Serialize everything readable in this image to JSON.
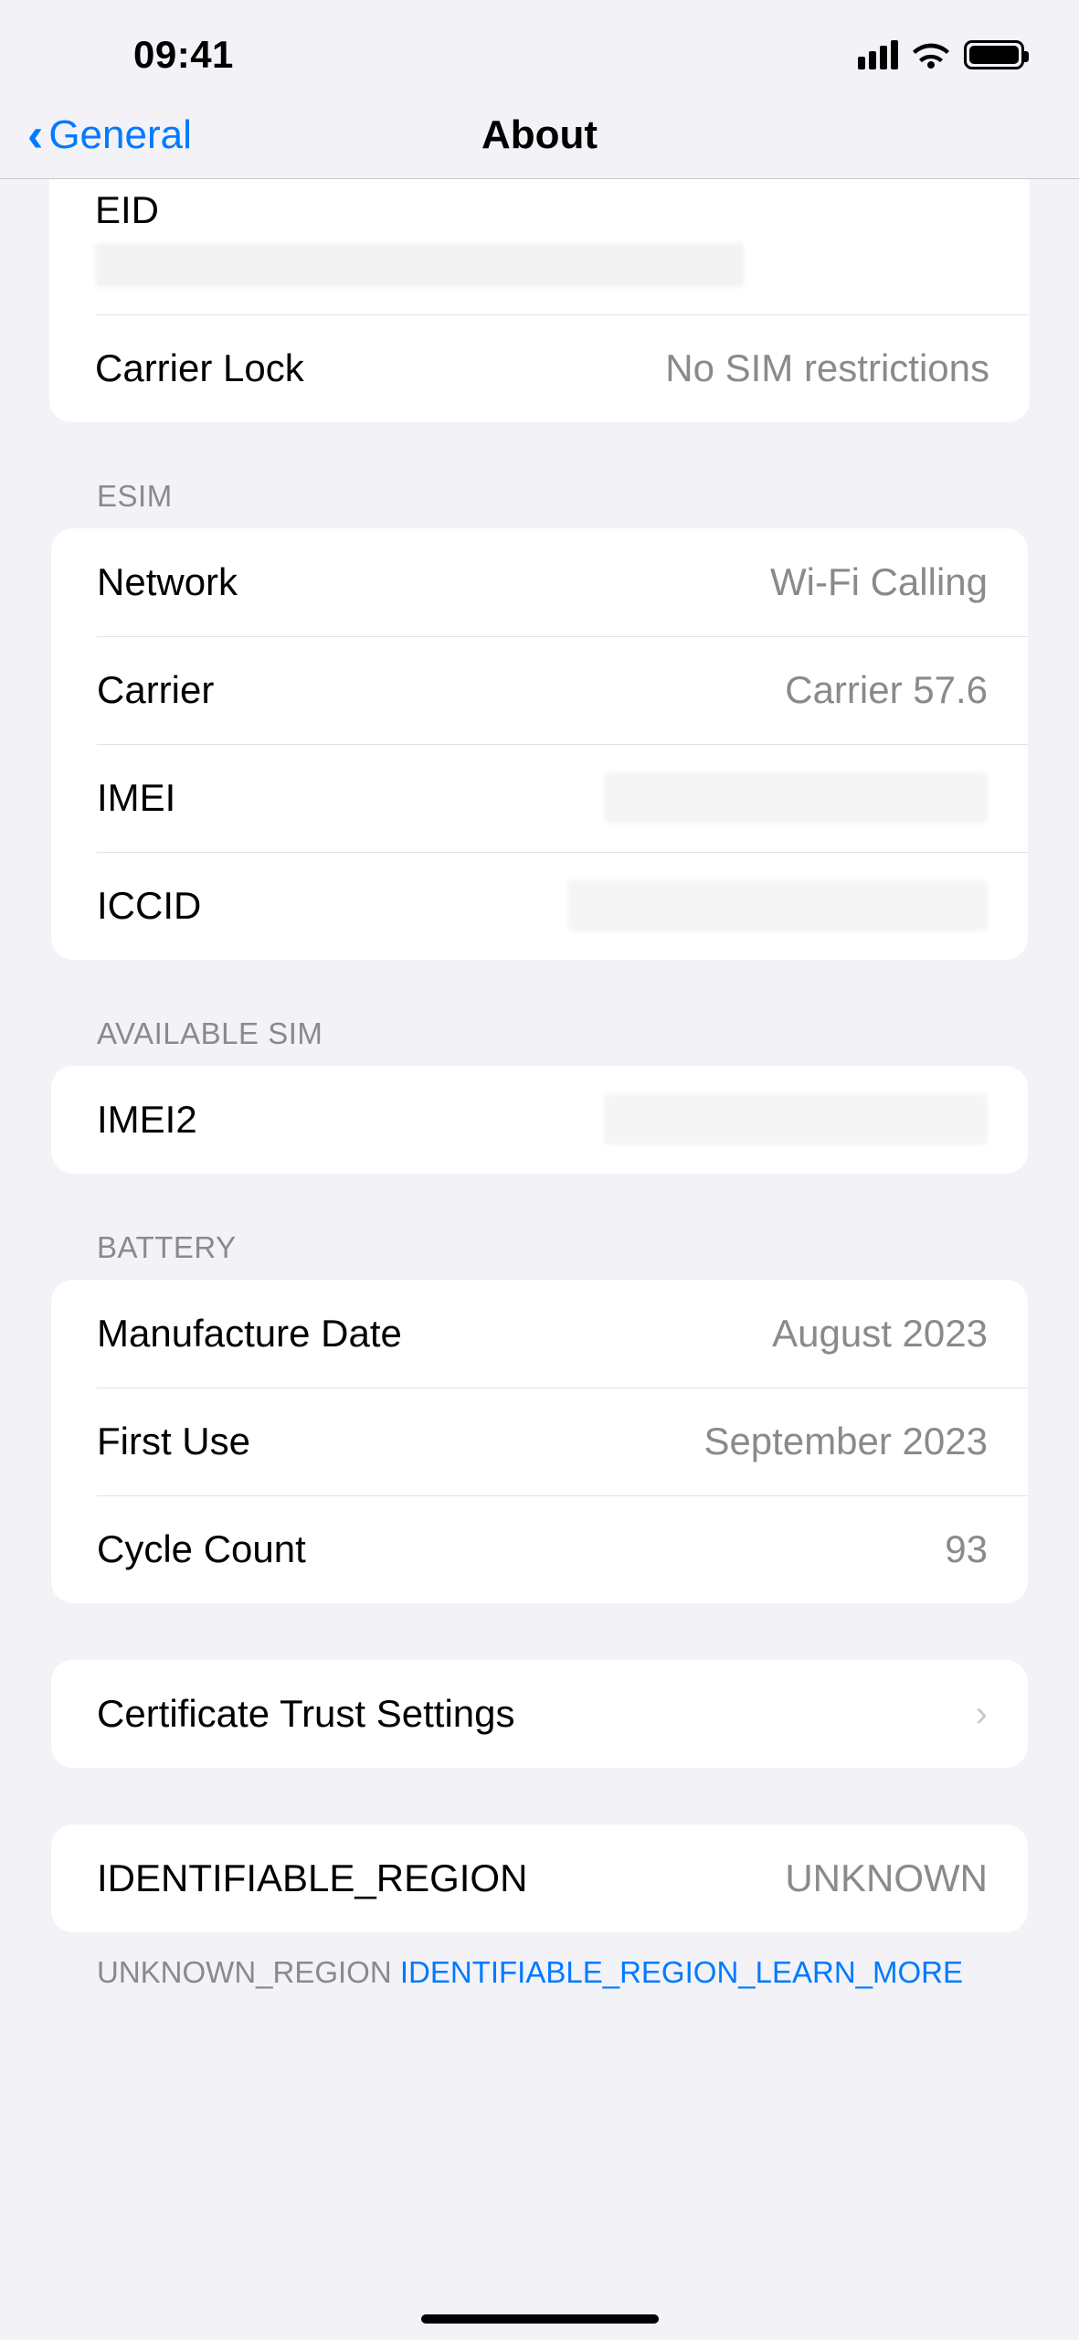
{
  "status": {
    "time": "09:41"
  },
  "nav": {
    "back": "General",
    "title": "About"
  },
  "top_group": {
    "eid_label": "EID",
    "carrier_lock_label": "Carrier Lock",
    "carrier_lock_value": "No SIM restrictions"
  },
  "esim": {
    "header": "ESIM",
    "network_label": "Network",
    "network_value": "Wi-Fi Calling",
    "carrier_label": "Carrier",
    "carrier_value": "Carrier 57.6",
    "imei_label": "IMEI",
    "iccid_label": "ICCID"
  },
  "available_sim": {
    "header": "AVAILABLE SIM",
    "imei2_label": "IMEI2"
  },
  "battery": {
    "header": "BATTERY",
    "manufacture_label": "Manufacture Date",
    "manufacture_value": "August 2023",
    "first_use_label": "First Use",
    "first_use_value": "September 2023",
    "cycle_label": "Cycle Count",
    "cycle_value": "93"
  },
  "cert": {
    "label": "Certificate Trust Settings"
  },
  "region": {
    "label": "IDENTIFIABLE_REGION",
    "value": "UNKNOWN",
    "footer_prefix": "UNKNOWN_REGION ",
    "footer_link": "IDENTIFIABLE_REGION_LEARN_MORE"
  }
}
